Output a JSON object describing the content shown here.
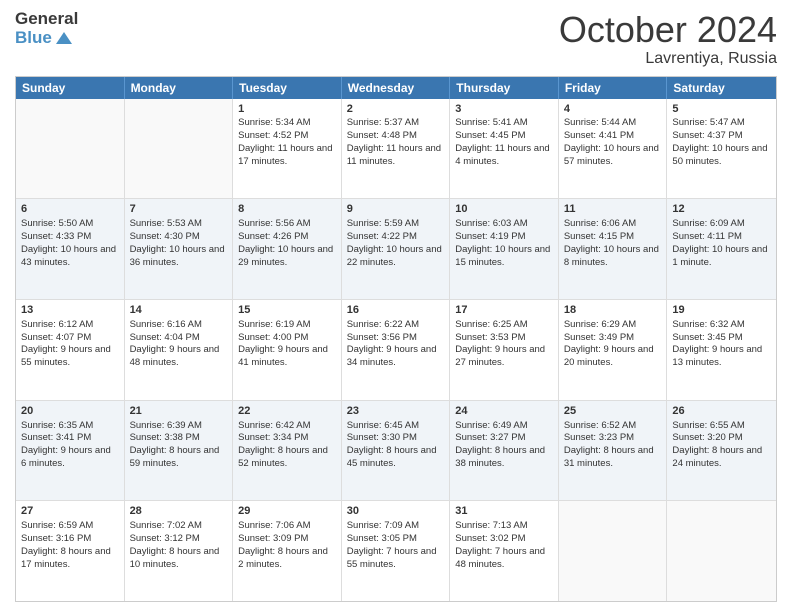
{
  "header": {
    "logo_line1": "General",
    "logo_line2": "Blue",
    "month": "October 2024",
    "location": "Lavrentiya, Russia"
  },
  "days_of_week": [
    "Sunday",
    "Monday",
    "Tuesday",
    "Wednesday",
    "Thursday",
    "Friday",
    "Saturday"
  ],
  "rows": [
    {
      "alt": false,
      "cells": [
        {
          "day": "",
          "sunrise": "",
          "sunset": "",
          "daylight": ""
        },
        {
          "day": "",
          "sunrise": "",
          "sunset": "",
          "daylight": ""
        },
        {
          "day": "1",
          "sunrise": "Sunrise: 5:34 AM",
          "sunset": "Sunset: 4:52 PM",
          "daylight": "Daylight: 11 hours and 17 minutes."
        },
        {
          "day": "2",
          "sunrise": "Sunrise: 5:37 AM",
          "sunset": "Sunset: 4:48 PM",
          "daylight": "Daylight: 11 hours and 11 minutes."
        },
        {
          "day": "3",
          "sunrise": "Sunrise: 5:41 AM",
          "sunset": "Sunset: 4:45 PM",
          "daylight": "Daylight: 11 hours and 4 minutes."
        },
        {
          "day": "4",
          "sunrise": "Sunrise: 5:44 AM",
          "sunset": "Sunset: 4:41 PM",
          "daylight": "Daylight: 10 hours and 57 minutes."
        },
        {
          "day": "5",
          "sunrise": "Sunrise: 5:47 AM",
          "sunset": "Sunset: 4:37 PM",
          "daylight": "Daylight: 10 hours and 50 minutes."
        }
      ]
    },
    {
      "alt": true,
      "cells": [
        {
          "day": "6",
          "sunrise": "Sunrise: 5:50 AM",
          "sunset": "Sunset: 4:33 PM",
          "daylight": "Daylight: 10 hours and 43 minutes."
        },
        {
          "day": "7",
          "sunrise": "Sunrise: 5:53 AM",
          "sunset": "Sunset: 4:30 PM",
          "daylight": "Daylight: 10 hours and 36 minutes."
        },
        {
          "day": "8",
          "sunrise": "Sunrise: 5:56 AM",
          "sunset": "Sunset: 4:26 PM",
          "daylight": "Daylight: 10 hours and 29 minutes."
        },
        {
          "day": "9",
          "sunrise": "Sunrise: 5:59 AM",
          "sunset": "Sunset: 4:22 PM",
          "daylight": "Daylight: 10 hours and 22 minutes."
        },
        {
          "day": "10",
          "sunrise": "Sunrise: 6:03 AM",
          "sunset": "Sunset: 4:19 PM",
          "daylight": "Daylight: 10 hours and 15 minutes."
        },
        {
          "day": "11",
          "sunrise": "Sunrise: 6:06 AM",
          "sunset": "Sunset: 4:15 PM",
          "daylight": "Daylight: 10 hours and 8 minutes."
        },
        {
          "day": "12",
          "sunrise": "Sunrise: 6:09 AM",
          "sunset": "Sunset: 4:11 PM",
          "daylight": "Daylight: 10 hours and 1 minute."
        }
      ]
    },
    {
      "alt": false,
      "cells": [
        {
          "day": "13",
          "sunrise": "Sunrise: 6:12 AM",
          "sunset": "Sunset: 4:07 PM",
          "daylight": "Daylight: 9 hours and 55 minutes."
        },
        {
          "day": "14",
          "sunrise": "Sunrise: 6:16 AM",
          "sunset": "Sunset: 4:04 PM",
          "daylight": "Daylight: 9 hours and 48 minutes."
        },
        {
          "day": "15",
          "sunrise": "Sunrise: 6:19 AM",
          "sunset": "Sunset: 4:00 PM",
          "daylight": "Daylight: 9 hours and 41 minutes."
        },
        {
          "day": "16",
          "sunrise": "Sunrise: 6:22 AM",
          "sunset": "Sunset: 3:56 PM",
          "daylight": "Daylight: 9 hours and 34 minutes."
        },
        {
          "day": "17",
          "sunrise": "Sunrise: 6:25 AM",
          "sunset": "Sunset: 3:53 PM",
          "daylight": "Daylight: 9 hours and 27 minutes."
        },
        {
          "day": "18",
          "sunrise": "Sunrise: 6:29 AM",
          "sunset": "Sunset: 3:49 PM",
          "daylight": "Daylight: 9 hours and 20 minutes."
        },
        {
          "day": "19",
          "sunrise": "Sunrise: 6:32 AM",
          "sunset": "Sunset: 3:45 PM",
          "daylight": "Daylight: 9 hours and 13 minutes."
        }
      ]
    },
    {
      "alt": true,
      "cells": [
        {
          "day": "20",
          "sunrise": "Sunrise: 6:35 AM",
          "sunset": "Sunset: 3:41 PM",
          "daylight": "Daylight: 9 hours and 6 minutes."
        },
        {
          "day": "21",
          "sunrise": "Sunrise: 6:39 AM",
          "sunset": "Sunset: 3:38 PM",
          "daylight": "Daylight: 8 hours and 59 minutes."
        },
        {
          "day": "22",
          "sunrise": "Sunrise: 6:42 AM",
          "sunset": "Sunset: 3:34 PM",
          "daylight": "Daylight: 8 hours and 52 minutes."
        },
        {
          "day": "23",
          "sunrise": "Sunrise: 6:45 AM",
          "sunset": "Sunset: 3:30 PM",
          "daylight": "Daylight: 8 hours and 45 minutes."
        },
        {
          "day": "24",
          "sunrise": "Sunrise: 6:49 AM",
          "sunset": "Sunset: 3:27 PM",
          "daylight": "Daylight: 8 hours and 38 minutes."
        },
        {
          "day": "25",
          "sunrise": "Sunrise: 6:52 AM",
          "sunset": "Sunset: 3:23 PM",
          "daylight": "Daylight: 8 hours and 31 minutes."
        },
        {
          "day": "26",
          "sunrise": "Sunrise: 6:55 AM",
          "sunset": "Sunset: 3:20 PM",
          "daylight": "Daylight: 8 hours and 24 minutes."
        }
      ]
    },
    {
      "alt": false,
      "cells": [
        {
          "day": "27",
          "sunrise": "Sunrise: 6:59 AM",
          "sunset": "Sunset: 3:16 PM",
          "daylight": "Daylight: 8 hours and 17 minutes."
        },
        {
          "day": "28",
          "sunrise": "Sunrise: 7:02 AM",
          "sunset": "Sunset: 3:12 PM",
          "daylight": "Daylight: 8 hours and 10 minutes."
        },
        {
          "day": "29",
          "sunrise": "Sunrise: 7:06 AM",
          "sunset": "Sunset: 3:09 PM",
          "daylight": "Daylight: 8 hours and 2 minutes."
        },
        {
          "day": "30",
          "sunrise": "Sunrise: 7:09 AM",
          "sunset": "Sunset: 3:05 PM",
          "daylight": "Daylight: 7 hours and 55 minutes."
        },
        {
          "day": "31",
          "sunrise": "Sunrise: 7:13 AM",
          "sunset": "Sunset: 3:02 PM",
          "daylight": "Daylight: 7 hours and 48 minutes."
        },
        {
          "day": "",
          "sunrise": "",
          "sunset": "",
          "daylight": ""
        },
        {
          "day": "",
          "sunrise": "",
          "sunset": "",
          "daylight": ""
        }
      ]
    }
  ]
}
